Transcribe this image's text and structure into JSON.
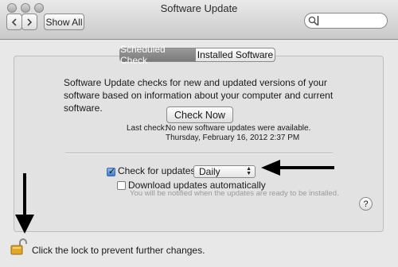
{
  "window": {
    "title": "Software Update"
  },
  "toolbar": {
    "show_all_label": "Show All"
  },
  "search": {
    "value": ""
  },
  "tabs": [
    {
      "label": "Scheduled Check",
      "active": true
    },
    {
      "label": "Installed Software",
      "active": false
    }
  ],
  "scheduled": {
    "description": "Software Update checks for new and updated versions of your software based on information about your computer and current software.",
    "check_now_label": "Check Now",
    "last_check_label": "Last check:",
    "last_check_status": "No new software updates were available.",
    "last_check_date": "Thursday, February 16, 2012 2:37 PM",
    "check_for_updates_label": "Check for updates:",
    "check_for_updates_checked": true,
    "frequency": "Daily",
    "download_auto_label": "Download updates automatically",
    "download_auto_checked": false,
    "download_hint": "You will be notified when the updates are ready to be installed."
  },
  "help": {
    "label": "?"
  },
  "lock": {
    "text": "Click the lock to prevent further changes."
  },
  "colors": {
    "annotation_arrow": "#000000",
    "active_tab": "#8a8a8a",
    "checkbox_checked": "#4a86d6"
  }
}
